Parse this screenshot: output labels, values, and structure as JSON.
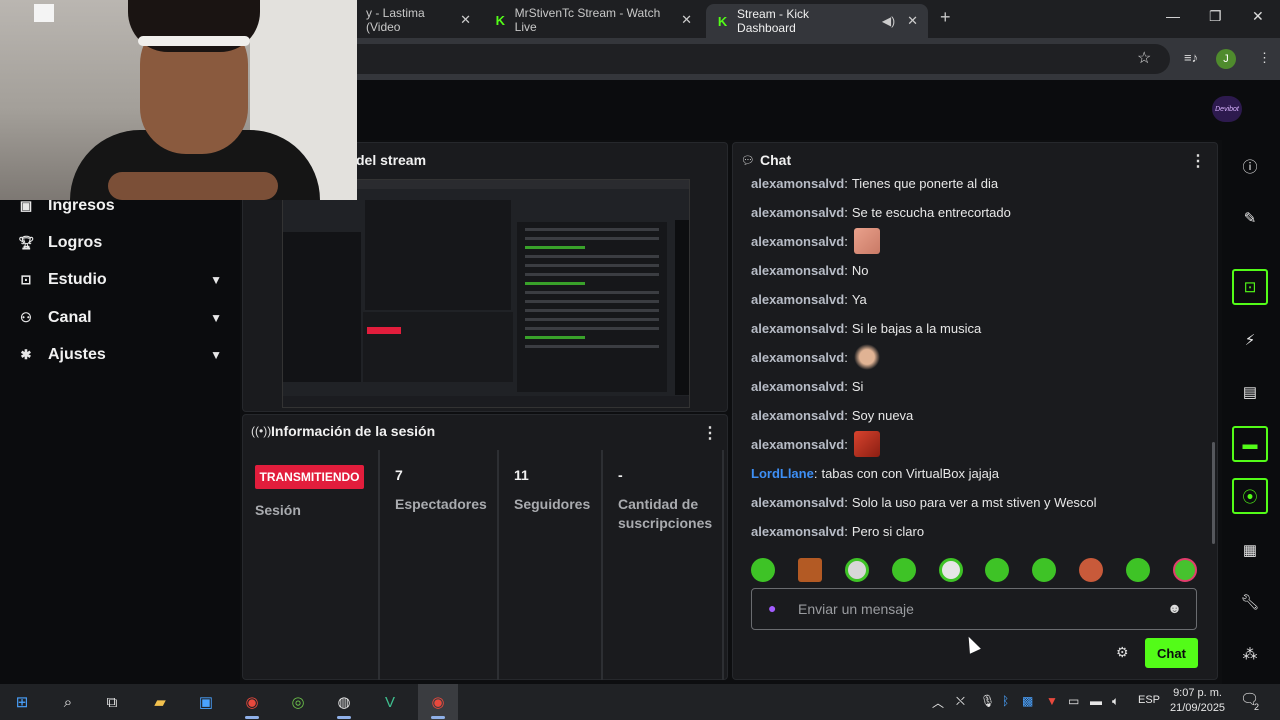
{
  "browser": {
    "tabs": [
      {
        "title": "y - Lastima (Video",
        "close": "✕"
      },
      {
        "title": "MrStivenTc Stream - Watch Live",
        "close": "✕"
      },
      {
        "title": "Stream - Kick Dashboard",
        "close": "✕",
        "active": true
      }
    ],
    "new_tab": "+",
    "profile_initial": "J"
  },
  "brand_logo_text": "Devibot",
  "sidebar": {
    "items": [
      {
        "label": "Ingresos",
        "icon": "chart-icon",
        "expandable": false
      },
      {
        "label": "Logros",
        "icon": "trophy-icon",
        "expandable": false
      },
      {
        "label": "Estudio",
        "icon": "studio-icon",
        "expandable": true
      },
      {
        "label": "Canal",
        "icon": "users-icon",
        "expandable": true
      },
      {
        "label": "Ajustes",
        "icon": "gear-icon",
        "expandable": true
      }
    ]
  },
  "preview": {
    "title": "del stream"
  },
  "session": {
    "title": "Información de la sesión",
    "status_badge": "TRANSMITIENDO",
    "status_label": "Sesión",
    "viewers_value": "7",
    "viewers_label": "Espectadores",
    "followers_value": "11",
    "followers_label": "Seguidores",
    "subs_value": "-",
    "subs_label_1": "Cantidad de",
    "subs_label_2": "suscripciones"
  },
  "chat": {
    "title": "Chat",
    "messages": [
      {
        "user": "alexamonsalvd",
        "text": "Tienes que ponerte al dia"
      },
      {
        "user": "alexamonsalvd",
        "text": "Se te escucha entrecortado"
      },
      {
        "user": "alexamonsalvd",
        "text": "",
        "emote": "face-emote"
      },
      {
        "user": "alexamonsalvd",
        "text": "No"
      },
      {
        "user": "alexamonsalvd",
        "text": "Ya"
      },
      {
        "user": "alexamonsalvd",
        "text": "Si le bajas a la musica"
      },
      {
        "user": "alexamonsalvd",
        "text": "",
        "emote": "face-emote"
      },
      {
        "user": "alexamonsalvd",
        "text": "Si"
      },
      {
        "user": "alexamonsalvd",
        "text": "Soy nueva"
      },
      {
        "user": "alexamonsalvd",
        "text": "",
        "emote": "angry-face-emote"
      },
      {
        "user": "LordLlane",
        "text": "tabas con con VirtualBox jajaja",
        "color": "#3e8ff5"
      },
      {
        "user": "alexamonsalvd",
        "text": "Solo la uso para ver a mst stiven y Wescol"
      },
      {
        "user": "alexamonsalvd",
        "text": "Pero si claro"
      }
    ],
    "input_placeholder": "Enviar un mensaje",
    "send_label": "Chat"
  },
  "taskbar": {
    "language": "ESP",
    "time": "9:07 p. m.",
    "date": "21/09/2025",
    "notification_count": "2"
  },
  "colors": {
    "accent": "#53fc18",
    "live_badge": "#e21d3c",
    "link_user": "#3e8ff5"
  }
}
